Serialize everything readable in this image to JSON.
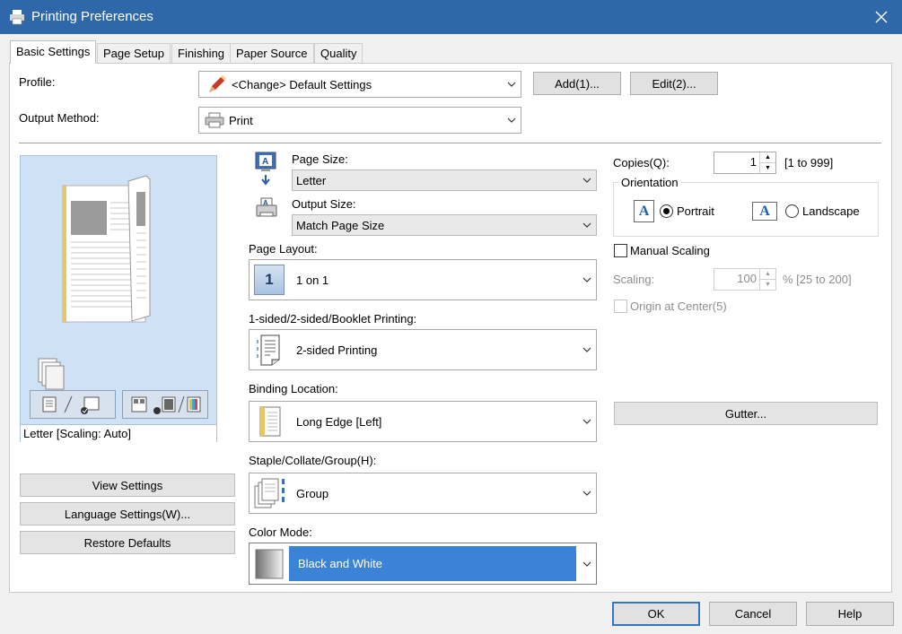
{
  "window": {
    "title": "Printing Preferences"
  },
  "tabs": [
    {
      "label": "Basic Settings",
      "active": true
    },
    {
      "label": "Page Setup"
    },
    {
      "label": "Finishing"
    },
    {
      "label": "Paper Source"
    },
    {
      "label": "Quality"
    }
  ],
  "profile": {
    "label": "Profile:",
    "value": "<Change> Default Settings",
    "add_label": "Add(1)...",
    "edit_label": "Edit(2)..."
  },
  "output_method": {
    "label": "Output Method:",
    "value": "Print"
  },
  "preview": {
    "status": "Letter [Scaling: Auto]"
  },
  "left_buttons": {
    "view_settings": "View Settings",
    "language_settings": "Language Settings(W)...",
    "restore_defaults": "Restore Defaults"
  },
  "page_size": {
    "label": "Page Size:",
    "value": "Letter"
  },
  "output_size": {
    "label": "Output Size:",
    "value": "Match Page Size"
  },
  "page_layout": {
    "label": "Page Layout:",
    "value": "1 on 1",
    "icon_text": "1"
  },
  "sided": {
    "label": "1-sided/2-sided/Booklet Printing:",
    "value": "2-sided Printing"
  },
  "binding": {
    "label": "Binding Location:",
    "value": "Long Edge [Left]"
  },
  "staple": {
    "label": "Staple/Collate/Group(H):",
    "value": "Group"
  },
  "color_mode": {
    "label": "Color Mode:",
    "value": "Black and White"
  },
  "copies": {
    "label": "Copies(Q):",
    "value": "1",
    "range": "[1 to 999]"
  },
  "orientation": {
    "label": "Orientation",
    "portrait": "Portrait",
    "landscape": "Landscape",
    "selected": "Portrait",
    "icon_letter": "A"
  },
  "manual_scaling": {
    "label": "Manual Scaling",
    "checked": false
  },
  "scaling": {
    "label": "Scaling:",
    "value": "100",
    "range": "% [25 to 200]"
  },
  "origin_center": {
    "label": "Origin at Center(5)",
    "checked": false
  },
  "gutter": {
    "label": "Gutter..."
  },
  "footer": {
    "ok": "OK",
    "cancel": "Cancel",
    "help": "Help"
  },
  "colors": {
    "titlebar": "#2f68a8",
    "accent": "#3a83d6",
    "preview_bg": "#cfe2f5"
  }
}
